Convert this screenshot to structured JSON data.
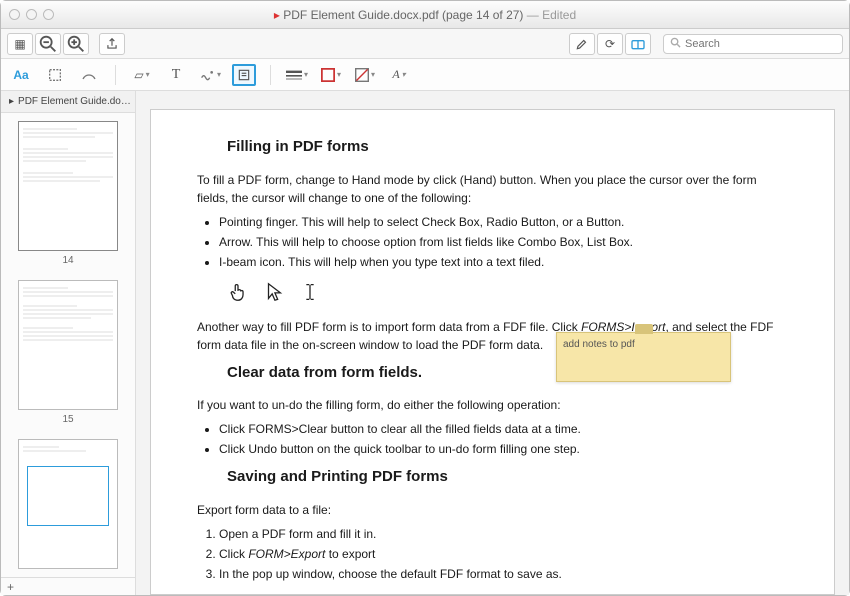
{
  "title": {
    "file": "PDF Element Guide.docx.pdf",
    "page": "(page 14 of 27)",
    "edited": "— Edited"
  },
  "search": {
    "placeholder": "Search"
  },
  "sidebar": {
    "tab": "PDF Element Guide.docx.pdf",
    "thumbs": [
      {
        "num": "14"
      },
      {
        "num": "15"
      },
      {
        "num": ""
      }
    ]
  },
  "doc": {
    "h1": "Filling in PDF forms",
    "p1": "To fill a PDF form, change to Hand mode by click (Hand) button. When you place the cursor over the form fields, the cursor will change to one of the following:",
    "b1": "Pointing finger. This will help to select Check Box, Radio Button, or a Button.",
    "b2": "Arrow. This will help to choose option from list fields like Combo Box, List Box.",
    "b3": "I-beam icon. This will help when you type text into a text filed.",
    "p2a": "Another way to fill PDF form is to import form data from a FDF file. Click ",
    "p2b": "FORMS>Import",
    "p2c": ", and select the FDF form data file in the on-screen window to load the PDF form data.",
    "h2": "Clear data from form fields.",
    "p3": "If you want to un-do the filling form, do either the following operation:",
    "b4": "Click FORMS>Clear button to clear all the filled fields data at a time.",
    "b5": "Click Undo button on the quick toolbar to un-do form filling one step.",
    "h3": "Saving and Printing PDF forms",
    "p4": "Export form data to a file:",
    "o1": "Open a PDF form and fill it in.",
    "o2a": "Click ",
    "o2b": "FORM>Export",
    "o2c": " to export",
    "o3": "In the pop up window, choose the default FDF format to save as."
  },
  "note": {
    "text": "add notes to pdf"
  }
}
